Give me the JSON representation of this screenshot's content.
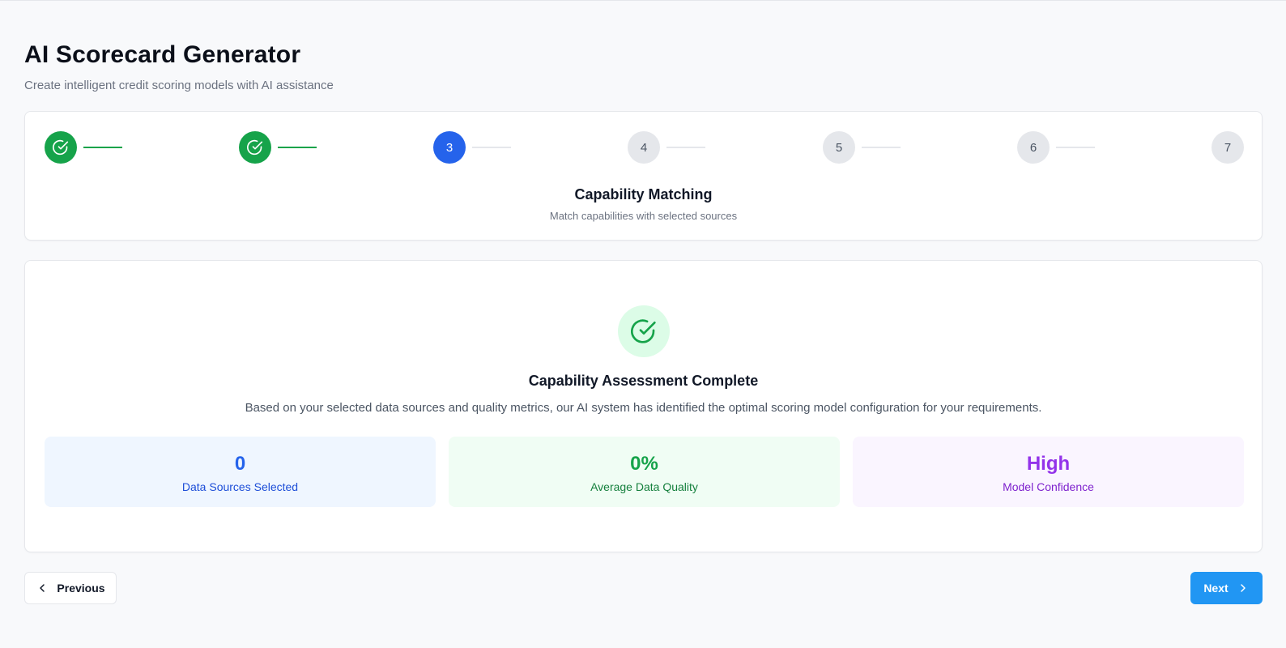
{
  "header": {
    "title": "AI Scorecard Generator",
    "subtitle": "Create intelligent credit scoring models with AI assistance"
  },
  "stepper": {
    "steps": [
      {
        "label": "1",
        "status": "completed",
        "icon": "check-circle-icon"
      },
      {
        "label": "2",
        "status": "completed",
        "icon": "check-circle-icon"
      },
      {
        "label": "3",
        "status": "active"
      },
      {
        "label": "4",
        "status": "pending"
      },
      {
        "label": "5",
        "status": "pending"
      },
      {
        "label": "6",
        "status": "pending"
      },
      {
        "label": "7",
        "status": "pending"
      }
    ],
    "current_title": "Capability Matching",
    "current_description": "Match capabilities with selected sources"
  },
  "assessment": {
    "icon": "check-circle-icon",
    "title": "Capability Assessment Complete",
    "description": "Based on your selected data sources and quality metrics, our AI system has identified the optimal scoring model configuration for your requirements.",
    "metrics": [
      {
        "value": "0",
        "label": "Data Sources Selected",
        "color": "#2563eb"
      },
      {
        "value": "0%",
        "label": "Average Data Quality",
        "color": "#16a34a"
      },
      {
        "value": "High",
        "label": "Model Confidence",
        "color": "#9333ea"
      }
    ]
  },
  "navigation": {
    "previous_label": "Previous",
    "previous_icon": "chevron-left-icon",
    "next_label": "Next",
    "next_icon": "chevron-right-icon"
  },
  "colors": {
    "completed": "#16a34a",
    "active": "#2563eb",
    "pending": "#e5e7eb",
    "primary_button": "#2196f3"
  }
}
